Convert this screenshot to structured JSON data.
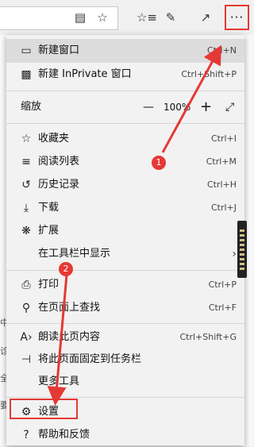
{
  "toolbar": {
    "reading_view_icon": "book-icon",
    "favorite_star_icon": "star-icon",
    "favorites_hub_icon": "star-list-icon",
    "notes_icon": "pen-icon",
    "share_icon": "share-icon",
    "more_label": "···"
  },
  "menu": {
    "items": [
      {
        "icon": "window-icon",
        "label": "新建窗口",
        "shortcut": "Ctrl+N"
      },
      {
        "icon": "private-window-icon",
        "label": "新建 InPrivate 窗口",
        "shortcut": "Ctrl+Shift+P"
      },
      {
        "icon": "",
        "label": "缩放",
        "shortcut": ""
      },
      {
        "icon": "favorites-icon",
        "label": "收藏夹",
        "shortcut": "Ctrl+I"
      },
      {
        "icon": "reading-list-icon",
        "label": "阅读列表",
        "shortcut": "Ctrl+M"
      },
      {
        "icon": "history-icon",
        "label": "历史记录",
        "shortcut": "Ctrl+H"
      },
      {
        "icon": "download-icon",
        "label": "下载",
        "shortcut": "Ctrl+J"
      },
      {
        "icon": "extensions-icon",
        "label": "扩展",
        "shortcut": ""
      },
      {
        "icon": "",
        "label": "在工具栏中显示",
        "shortcut": ""
      },
      {
        "icon": "print-icon",
        "label": "打印",
        "shortcut": "Ctrl+P"
      },
      {
        "icon": "find-icon",
        "label": "在页面上查找",
        "shortcut": "Ctrl+F"
      },
      {
        "icon": "read-aloud-icon",
        "label": "朗读此页内容",
        "shortcut": "Ctrl+Shift+G"
      },
      {
        "icon": "pin-icon",
        "label": "将此页面固定到任务栏",
        "shortcut": ""
      },
      {
        "icon": "",
        "label": "更多工具",
        "shortcut": ""
      },
      {
        "icon": "settings-icon",
        "label": "设置",
        "shortcut": ""
      },
      {
        "icon": "help-icon",
        "label": "帮助和反馈",
        "shortcut": ""
      }
    ],
    "zoom": {
      "minus": "—",
      "value": "100%",
      "plus": "+",
      "fullscreen": "⤢"
    }
  },
  "annotations": {
    "badge1": "1",
    "badge2": "2",
    "color": "#e53935"
  },
  "background_peek": [
    "中",
    "诊",
    "全",
    "要"
  ]
}
